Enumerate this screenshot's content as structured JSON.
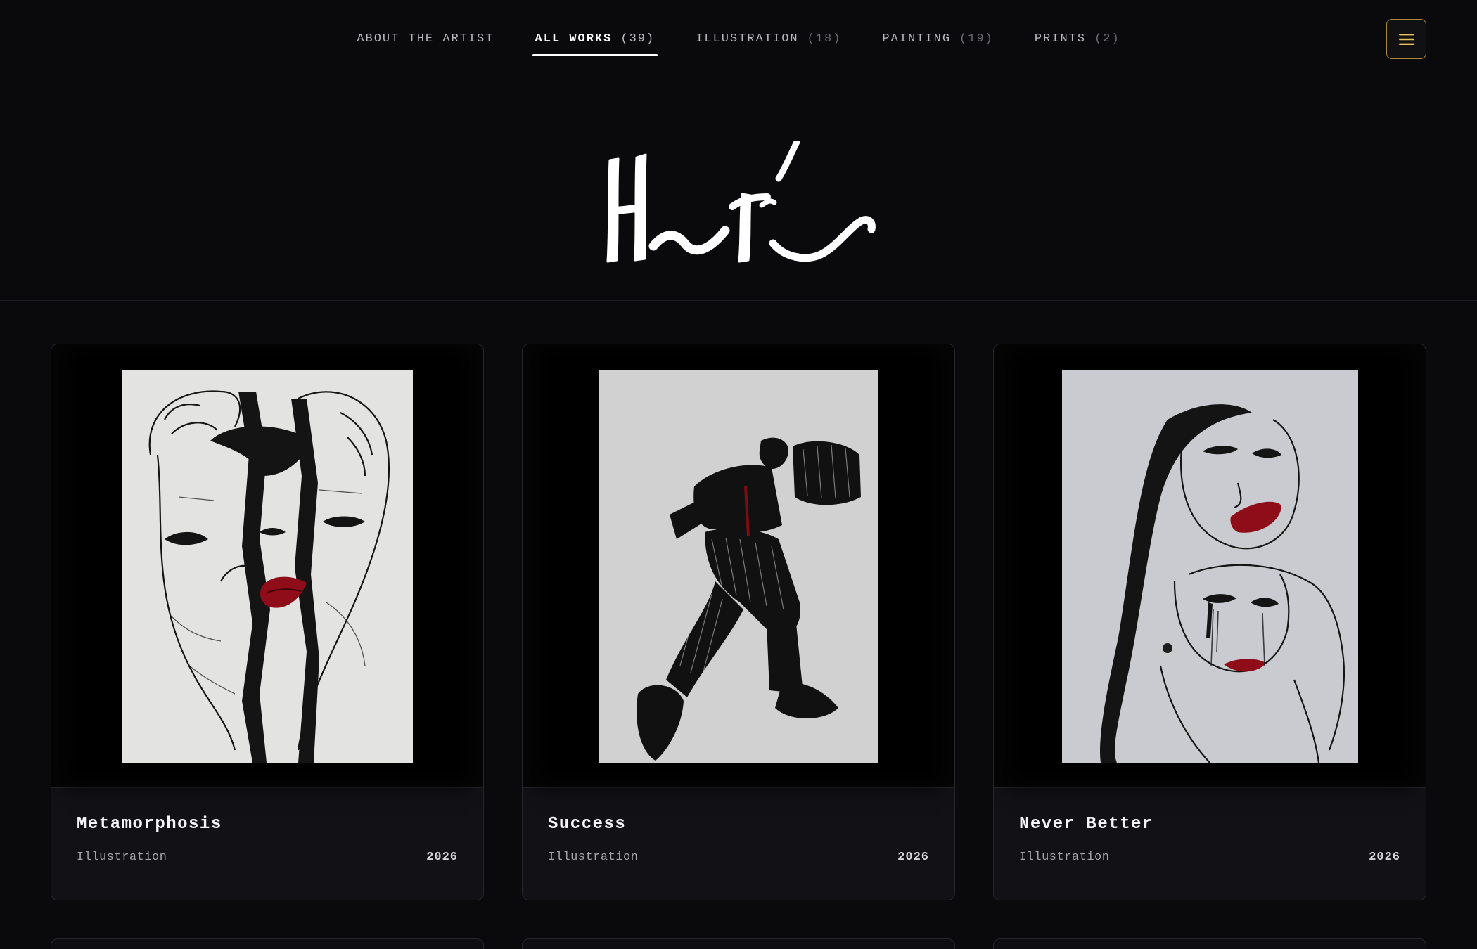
{
  "nav": {
    "tabs": [
      {
        "label": "ABOUT THE ARTIST",
        "count": ""
      },
      {
        "label": "ALL WORKS",
        "count": "(39)"
      },
      {
        "label": "ILLUSTRATION",
        "count": "(18)"
      },
      {
        "label": "PAINTING",
        "count": "(19)"
      },
      {
        "label": "PRINTS",
        "count": "(2)"
      }
    ],
    "active_tab": "ALL WORKS",
    "menu_icon": "hamburger-icon",
    "accent": "#a98a3c"
  },
  "hero": {
    "logo": "brush-signature-logo"
  },
  "works": [
    {
      "title": "Metamorphosis",
      "category": "Illustration",
      "year": "2026"
    },
    {
      "title": "Success",
      "category": "Illustration",
      "year": "2026"
    },
    {
      "title": "Never Better",
      "category": "Illustration",
      "year": "2026"
    }
  ],
  "colors": {
    "background": "#0a0a0d",
    "card": "#111116",
    "lip_red": "#8e0d18"
  }
}
